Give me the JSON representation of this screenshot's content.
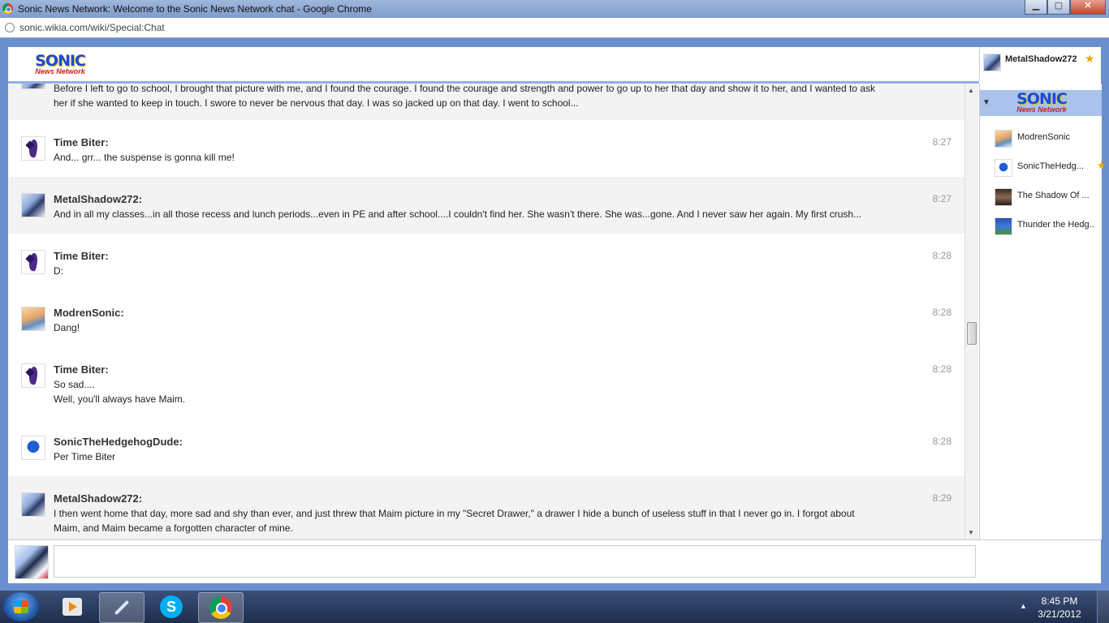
{
  "window": {
    "title": "Sonic News Network: Welcome to the Sonic News Network chat - Google Chrome",
    "minimize": "▁",
    "maximize": "▢",
    "close": "✕"
  },
  "browser": {
    "url": "sonic.wikia.com/wiki/Special:Chat"
  },
  "site": {
    "logo_main": "SONIC",
    "logo_sub": "News Network"
  },
  "current_user": {
    "name": "MetalShadow272",
    "star": "★"
  },
  "chat": {
    "messages": [
      {
        "user": "",
        "time": "",
        "avatar": "metal",
        "lines": [
          "Before I left to go to school, I brought that picture with me, and I found the courage. I found the courage and strength and power to go up to her that day and show it to her, and I wanted to ask",
          "her if she wanted to keep in touch. I swore to never be nervous that day. I was so jacked up on that day. I went to school..."
        ]
      },
      {
        "user": "Time Biter:",
        "time": "8:27",
        "avatar": "timebiter",
        "lines": [
          "And... grr... the suspense is gonna kill me!"
        ]
      },
      {
        "user": "MetalShadow272:",
        "time": "8:27",
        "avatar": "metal",
        "lines": [
          "And in all my classes...in all those recess and lunch periods...even in PE and after school....I couldn't find her. She wasn't there. She was...gone. And I never saw her again. My first crush..."
        ]
      },
      {
        "user": "Time Biter:",
        "time": "8:28",
        "avatar": "timebiter",
        "lines": [
          "D:"
        ]
      },
      {
        "user": "ModrenSonic:",
        "time": "8:28",
        "avatar": "modren",
        "lines": [
          "Dang!"
        ]
      },
      {
        "user": "Time Biter:",
        "time": "8:28",
        "avatar": "timebiter",
        "lines": [
          "So sad....",
          "Well, you'll always have Maim."
        ]
      },
      {
        "user": "SonicTheHedgehogDude:",
        "time": "8:28",
        "avatar": "sonic",
        "lines": [
          "Per Time Biter"
        ]
      },
      {
        "user": "MetalShadow272:",
        "time": "8:29",
        "avatar": "metal",
        "lines": [
          "I then went home that day, more sad and shy than ever, and just threw that Maim picture in my \"Secret Drawer,\" a drawer I hide a bunch of useless stuff in that I never go in. I forgot about",
          "Maim, and Maim became a forgotten character of mine."
        ]
      }
    ]
  },
  "userlist": {
    "users": [
      {
        "name": "ModrenSonic",
        "avatar": "modren",
        "star": ""
      },
      {
        "name": "SonicTheHedg...",
        "avatar": "sonic",
        "star": "★"
      },
      {
        "name": "The Shadow Of ...",
        "avatar": "shadow",
        "star": ""
      },
      {
        "name": "Thunder the Hedg...",
        "avatar": "thunder",
        "star": ""
      }
    ]
  },
  "taskbar": {
    "time": "8:45 PM",
    "date": "3/21/2012",
    "skype_letter": "S",
    "tray_arrow": "▲"
  },
  "scroll": {
    "up": "▲",
    "down": "▼"
  },
  "room": {
    "toggle": "▼"
  },
  "colors": {
    "accent": "#8fb0e8",
    "room_bg": "#a9c3ec",
    "star": "#e8a800",
    "logo_blue": "#1a4bd6",
    "logo_red": "#c81e1e"
  }
}
